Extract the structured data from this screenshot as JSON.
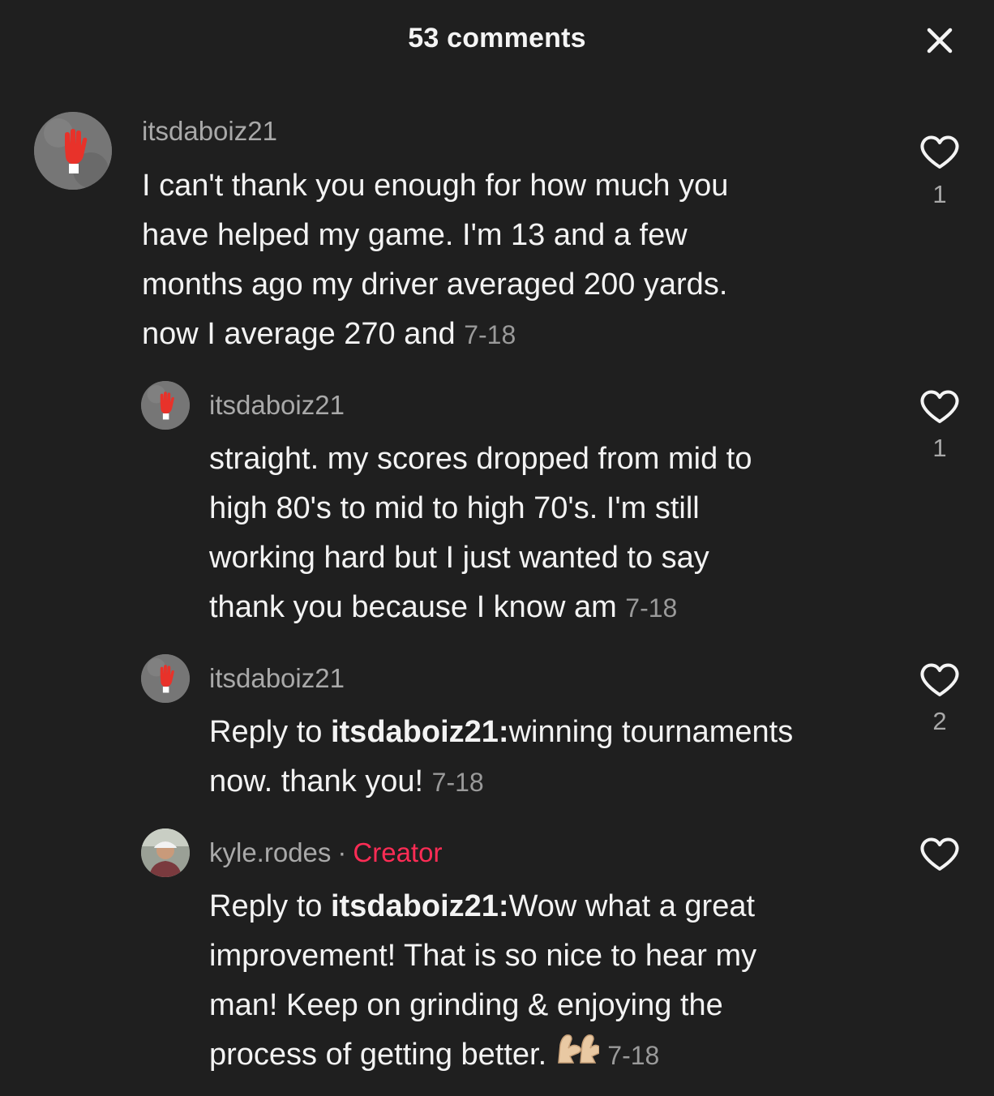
{
  "header": {
    "title": "53 comments",
    "close_icon": "close-icon"
  },
  "colors": {
    "background": "#1f1f1f",
    "creator_tag": "#fe2c55",
    "muted": "#a9a9a9"
  },
  "comments": [
    {
      "username": "itsdaboiz21",
      "avatar_icon": "red-glove-avatar",
      "text": "I can't thank you enough for how much you\nhave helped my game. I'm 13 and a few\nmonths ago my driver averaged 200 yards.\nnow I average 270 and ",
      "date": "7-18",
      "likes": "1"
    },
    {
      "username": "itsdaboiz21",
      "avatar_icon": "red-glove-avatar",
      "text": "straight. my scores dropped from mid to\nhigh 80's to mid to high 70's. I'm still\nworking hard but I just wanted to say\nthank you because I know am ",
      "date": "7-18",
      "likes": "1"
    },
    {
      "username": "itsdaboiz21",
      "avatar_icon": "red-glove-avatar",
      "reply_prefix": "Reply to ",
      "reply_to": "itsdaboiz21:",
      "text": "winning tournaments\nnow. thank you! ",
      "date": "7-18",
      "likes": "2"
    },
    {
      "username": "kyle.rodes",
      "separator": "·",
      "badge": "Creator",
      "avatar_icon": "profile-photo-avatar",
      "reply_prefix": "Reply to ",
      "reply_to": "itsdaboiz21:",
      "text": "Wow what a great\nimprovement! That is so nice to hear my\nman! Keep on grinding & enjoying the\nprocess of getting better. ",
      "emoji": "flexed-biceps-emoji",
      "date": "7-18",
      "likes": ""
    }
  ]
}
